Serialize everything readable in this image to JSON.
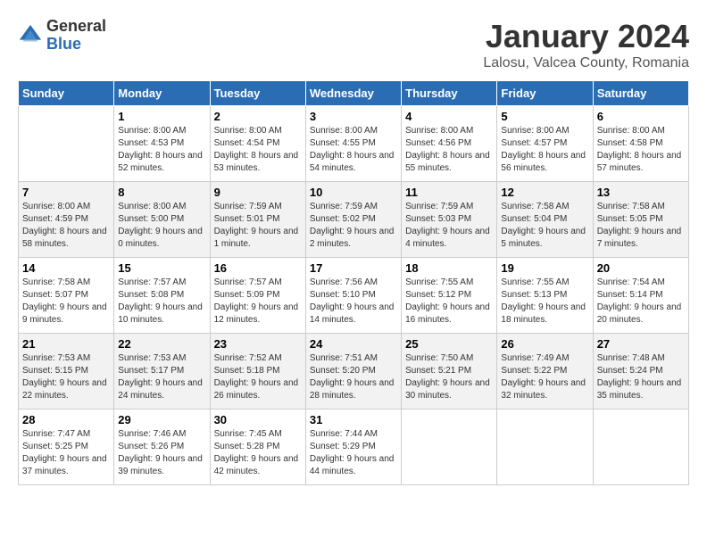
{
  "logo": {
    "general": "General",
    "blue": "Blue"
  },
  "title": "January 2024",
  "location": "Lalosu, Valcea County, Romania",
  "days_of_week": [
    "Sunday",
    "Monday",
    "Tuesday",
    "Wednesday",
    "Thursday",
    "Friday",
    "Saturday"
  ],
  "weeks": [
    [
      {
        "day": "",
        "sunrise": "",
        "sunset": "",
        "daylight": ""
      },
      {
        "day": "1",
        "sunrise": "Sunrise: 8:00 AM",
        "sunset": "Sunset: 4:53 PM",
        "daylight": "Daylight: 8 hours and 52 minutes."
      },
      {
        "day": "2",
        "sunrise": "Sunrise: 8:00 AM",
        "sunset": "Sunset: 4:54 PM",
        "daylight": "Daylight: 8 hours and 53 minutes."
      },
      {
        "day": "3",
        "sunrise": "Sunrise: 8:00 AM",
        "sunset": "Sunset: 4:55 PM",
        "daylight": "Daylight: 8 hours and 54 minutes."
      },
      {
        "day": "4",
        "sunrise": "Sunrise: 8:00 AM",
        "sunset": "Sunset: 4:56 PM",
        "daylight": "Daylight: 8 hours and 55 minutes."
      },
      {
        "day": "5",
        "sunrise": "Sunrise: 8:00 AM",
        "sunset": "Sunset: 4:57 PM",
        "daylight": "Daylight: 8 hours and 56 minutes."
      },
      {
        "day": "6",
        "sunrise": "Sunrise: 8:00 AM",
        "sunset": "Sunset: 4:58 PM",
        "daylight": "Daylight: 8 hours and 57 minutes."
      }
    ],
    [
      {
        "day": "7",
        "sunrise": "Sunrise: 8:00 AM",
        "sunset": "Sunset: 4:59 PM",
        "daylight": "Daylight: 8 hours and 58 minutes."
      },
      {
        "day": "8",
        "sunrise": "Sunrise: 8:00 AM",
        "sunset": "Sunset: 5:00 PM",
        "daylight": "Daylight: 9 hours and 0 minutes."
      },
      {
        "day": "9",
        "sunrise": "Sunrise: 7:59 AM",
        "sunset": "Sunset: 5:01 PM",
        "daylight": "Daylight: 9 hours and 1 minute."
      },
      {
        "day": "10",
        "sunrise": "Sunrise: 7:59 AM",
        "sunset": "Sunset: 5:02 PM",
        "daylight": "Daylight: 9 hours and 2 minutes."
      },
      {
        "day": "11",
        "sunrise": "Sunrise: 7:59 AM",
        "sunset": "Sunset: 5:03 PM",
        "daylight": "Daylight: 9 hours and 4 minutes."
      },
      {
        "day": "12",
        "sunrise": "Sunrise: 7:58 AM",
        "sunset": "Sunset: 5:04 PM",
        "daylight": "Daylight: 9 hours and 5 minutes."
      },
      {
        "day": "13",
        "sunrise": "Sunrise: 7:58 AM",
        "sunset": "Sunset: 5:05 PM",
        "daylight": "Daylight: 9 hours and 7 minutes."
      }
    ],
    [
      {
        "day": "14",
        "sunrise": "Sunrise: 7:58 AM",
        "sunset": "Sunset: 5:07 PM",
        "daylight": "Daylight: 9 hours and 9 minutes."
      },
      {
        "day": "15",
        "sunrise": "Sunrise: 7:57 AM",
        "sunset": "Sunset: 5:08 PM",
        "daylight": "Daylight: 9 hours and 10 minutes."
      },
      {
        "day": "16",
        "sunrise": "Sunrise: 7:57 AM",
        "sunset": "Sunset: 5:09 PM",
        "daylight": "Daylight: 9 hours and 12 minutes."
      },
      {
        "day": "17",
        "sunrise": "Sunrise: 7:56 AM",
        "sunset": "Sunset: 5:10 PM",
        "daylight": "Daylight: 9 hours and 14 minutes."
      },
      {
        "day": "18",
        "sunrise": "Sunrise: 7:55 AM",
        "sunset": "Sunset: 5:12 PM",
        "daylight": "Daylight: 9 hours and 16 minutes."
      },
      {
        "day": "19",
        "sunrise": "Sunrise: 7:55 AM",
        "sunset": "Sunset: 5:13 PM",
        "daylight": "Daylight: 9 hours and 18 minutes."
      },
      {
        "day": "20",
        "sunrise": "Sunrise: 7:54 AM",
        "sunset": "Sunset: 5:14 PM",
        "daylight": "Daylight: 9 hours and 20 minutes."
      }
    ],
    [
      {
        "day": "21",
        "sunrise": "Sunrise: 7:53 AM",
        "sunset": "Sunset: 5:15 PM",
        "daylight": "Daylight: 9 hours and 22 minutes."
      },
      {
        "day": "22",
        "sunrise": "Sunrise: 7:53 AM",
        "sunset": "Sunset: 5:17 PM",
        "daylight": "Daylight: 9 hours and 24 minutes."
      },
      {
        "day": "23",
        "sunrise": "Sunrise: 7:52 AM",
        "sunset": "Sunset: 5:18 PM",
        "daylight": "Daylight: 9 hours and 26 minutes."
      },
      {
        "day": "24",
        "sunrise": "Sunrise: 7:51 AM",
        "sunset": "Sunset: 5:20 PM",
        "daylight": "Daylight: 9 hours and 28 minutes."
      },
      {
        "day": "25",
        "sunrise": "Sunrise: 7:50 AM",
        "sunset": "Sunset: 5:21 PM",
        "daylight": "Daylight: 9 hours and 30 minutes."
      },
      {
        "day": "26",
        "sunrise": "Sunrise: 7:49 AM",
        "sunset": "Sunset: 5:22 PM",
        "daylight": "Daylight: 9 hours and 32 minutes."
      },
      {
        "day": "27",
        "sunrise": "Sunrise: 7:48 AM",
        "sunset": "Sunset: 5:24 PM",
        "daylight": "Daylight: 9 hours and 35 minutes."
      }
    ],
    [
      {
        "day": "28",
        "sunrise": "Sunrise: 7:47 AM",
        "sunset": "Sunset: 5:25 PM",
        "daylight": "Daylight: 9 hours and 37 minutes."
      },
      {
        "day": "29",
        "sunrise": "Sunrise: 7:46 AM",
        "sunset": "Sunset: 5:26 PM",
        "daylight": "Daylight: 9 hours and 39 minutes."
      },
      {
        "day": "30",
        "sunrise": "Sunrise: 7:45 AM",
        "sunset": "Sunset: 5:28 PM",
        "daylight": "Daylight: 9 hours and 42 minutes."
      },
      {
        "day": "31",
        "sunrise": "Sunrise: 7:44 AM",
        "sunset": "Sunset: 5:29 PM",
        "daylight": "Daylight: 9 hours and 44 minutes."
      },
      {
        "day": "",
        "sunrise": "",
        "sunset": "",
        "daylight": ""
      },
      {
        "day": "",
        "sunrise": "",
        "sunset": "",
        "daylight": ""
      },
      {
        "day": "",
        "sunrise": "",
        "sunset": "",
        "daylight": ""
      }
    ]
  ]
}
